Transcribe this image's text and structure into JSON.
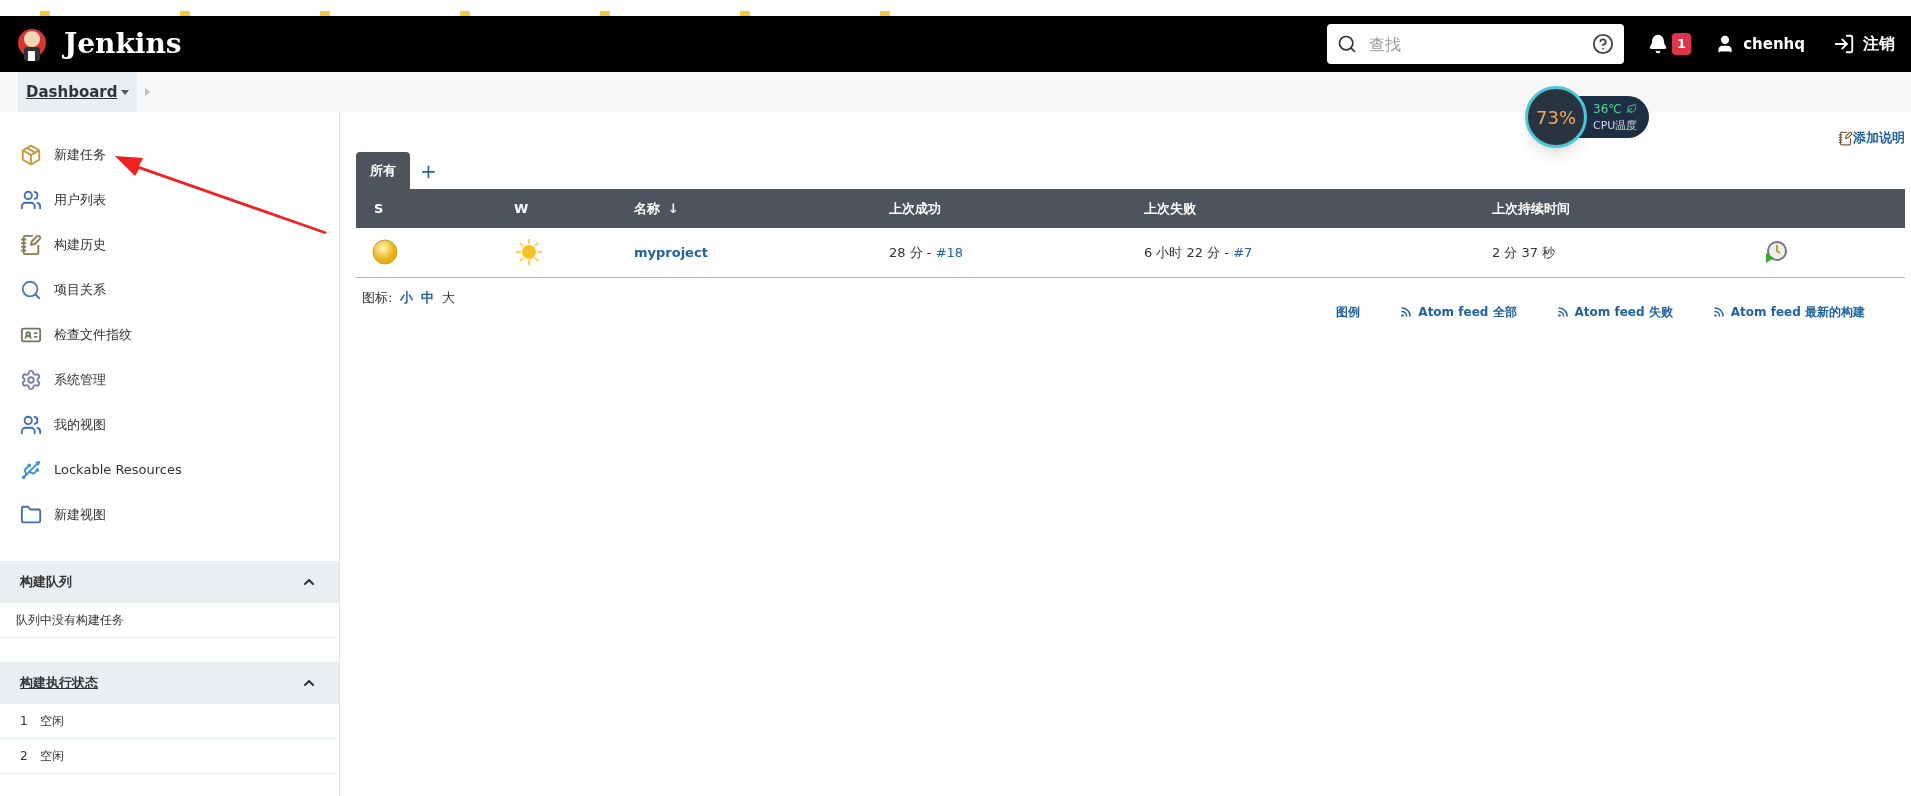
{
  "header": {
    "title": "Jenkins",
    "search": {
      "placeholder": "查找"
    },
    "notifications": "1",
    "user": "chenhq",
    "logout": "注销"
  },
  "breadcrumb": {
    "label": "Dashboard"
  },
  "sidebar": {
    "items": [
      {
        "label": "新建任务"
      },
      {
        "label": "用户列表"
      },
      {
        "label": "构建历史"
      },
      {
        "label": "项目关系"
      },
      {
        "label": "检查文件指纹"
      },
      {
        "label": "系统管理"
      },
      {
        "label": "我的视图"
      },
      {
        "label": "Lockable Resources"
      },
      {
        "label": "新建视图"
      }
    ],
    "build_queue": {
      "title": "构建队列",
      "expanded": true,
      "empty_text": "队列中没有构建任务"
    },
    "executors": {
      "title": "构建执行状态",
      "expanded": true,
      "rows": [
        {
          "number": "1",
          "state": "空闲"
        },
        {
          "number": "2",
          "state": "空闲"
        }
      ]
    }
  },
  "cpu_widget": {
    "percent": "73%",
    "temperature": "36℃",
    "label": "CPU温度"
  },
  "add_description": "添加说明",
  "tabs": [
    {
      "label": "所有",
      "selected": true
    }
  ],
  "add_tab": "+",
  "table": {
    "columns": [
      "S",
      "W",
      "名称",
      "上次成功",
      "上次失败",
      "上次持续时间"
    ],
    "sort_mark": "↓",
    "rows": [
      {
        "name": "myproject",
        "last_success": "28 分 - ",
        "success_build": "#18",
        "last_failure": "6 小时 22 分 - ",
        "failure_build": "#7",
        "duration": "2 分 37 秒"
      }
    ]
  },
  "icon_size": {
    "label": "图标:",
    "sizes": [
      {
        "label": "小",
        "selected": false
      },
      {
        "label": "中",
        "selected": false
      },
      {
        "label": "大",
        "selected": true
      }
    ]
  },
  "feed_links": [
    {
      "kind": "legend",
      "label": "图例"
    },
    {
      "kind": "feed",
      "label": "Atom feed 全部"
    },
    {
      "kind": "feed",
      "label": "Atom feed 失败"
    },
    {
      "kind": "feed",
      "label": "Atom feed 最新的构建"
    }
  ]
}
